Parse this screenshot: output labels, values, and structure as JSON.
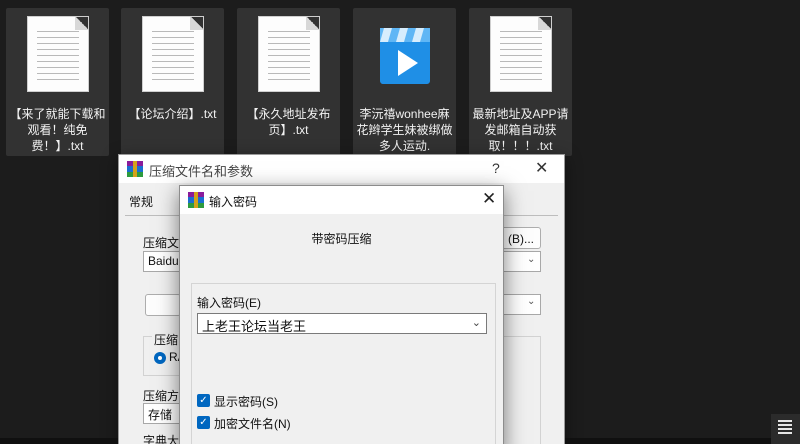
{
  "desktop": {
    "files": [
      {
        "name": "【来了就能下载和观看！纯免费！】.txt",
        "icon": "text-file-icon"
      },
      {
        "name": "【论坛介绍】.txt",
        "icon": "text-file-icon"
      },
      {
        "name": "【永久地址发布页】.txt",
        "icon": "text-file-icon"
      },
      {
        "name": "李沅禧wonhee麻花辫学生妹被绑做多人运动.",
        "icon": "video-file-icon"
      },
      {
        "name": "最新地址及APP请发邮箱自动获取！！！.txt",
        "icon": "text-file-icon"
      }
    ]
  },
  "archive_dialog": {
    "title": "压缩文件名和参数",
    "help": "?",
    "close": "✕",
    "tab_general": "常规",
    "archive_name_label": "压缩文",
    "archive_name_value": "BaiduN",
    "browse_button": "(B)...",
    "format_label": "压缩",
    "format_option": "RA",
    "method_label": "压缩方",
    "method_value": "存储",
    "dict_label": "字典大"
  },
  "password_dialog": {
    "title": "输入密码",
    "close": "✕",
    "heading": "带密码压缩",
    "password_label": "输入密码(E)",
    "password_value": "上老王论坛当老王",
    "show_password_label": "显示密码(S)",
    "encrypt_names_label": "加密文件名(N)",
    "check_mark": "✓"
  },
  "colors": {
    "accent": "#0067c0",
    "desktop_bg": "#1c1c1c",
    "tile_bg": "#323232"
  }
}
